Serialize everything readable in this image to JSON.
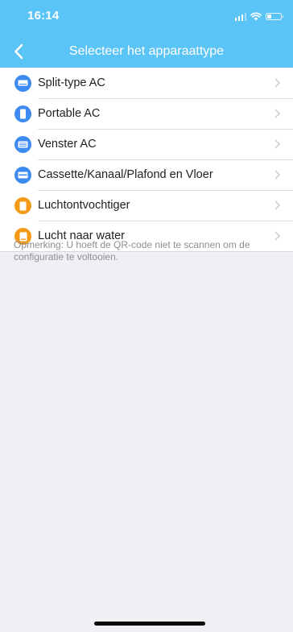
{
  "status_bar": {
    "time": "16:14",
    "icons": [
      "signal-icon",
      "wifi-icon",
      "battery-icon"
    ]
  },
  "nav": {
    "title": "Selecteer het apparaattype",
    "back_icon": "chevron-left-icon"
  },
  "colors": {
    "header": "#5bc4f7",
    "icon_blue": "#3d8af0",
    "icon_orange": "#f59a17",
    "background": "#efeff4",
    "note_text": "#8e8e93"
  },
  "device_types": [
    {
      "label": "Split-type AC",
      "icon": "split-ac-icon",
      "color": "blue"
    },
    {
      "label": "Portable AC",
      "icon": "portable-ac-icon",
      "color": "blue"
    },
    {
      "label": "Venster AC",
      "icon": "window-ac-icon",
      "color": "blue"
    },
    {
      "label": "Cassette/Kanaal/Plafond en Vloer",
      "icon": "cassette-ac-icon",
      "color": "blue"
    },
    {
      "label": "Luchtontvochtiger",
      "icon": "dehumidifier-icon",
      "color": "orange"
    },
    {
      "label": "Lucht naar water",
      "icon": "air-to-water-icon",
      "color": "orange"
    }
  ],
  "note": "Opmerking: U hoeft de QR-code niet te scannen om de configuratie te voltooien."
}
